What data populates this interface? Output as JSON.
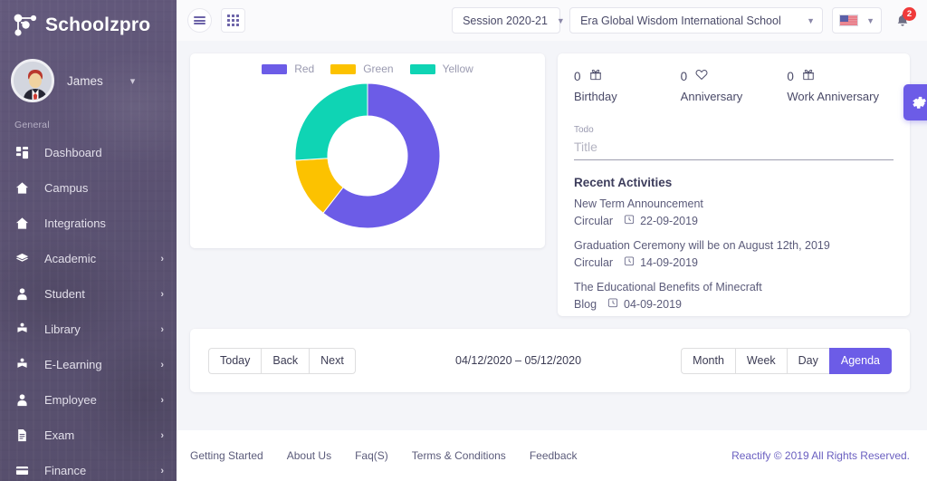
{
  "brand": {
    "name": "Schoolzpro",
    "logo_icon": "schoolzpro-logo-icon"
  },
  "profile": {
    "name": "James",
    "caret_icon": "chevron-down-icon",
    "avatar_icon": "user-avatar"
  },
  "sidebar": {
    "section_label": "General",
    "items": [
      {
        "label": "Dashboard",
        "icon": "dashboard-grid-icon",
        "arrow": ""
      },
      {
        "label": "Campus",
        "icon": "home-icon",
        "arrow": ""
      },
      {
        "label": "Integrations",
        "icon": "home-icon",
        "arrow": ""
      },
      {
        "label": "Academic",
        "icon": "books-stack-icon",
        "arrow": "›"
      },
      {
        "label": "Student",
        "icon": "user-icon",
        "arrow": "›"
      },
      {
        "label": "Library",
        "icon": "book-reader-icon",
        "arrow": "›"
      },
      {
        "label": "E-Learning",
        "icon": "book-reader-icon",
        "arrow": "›"
      },
      {
        "label": "Employee",
        "icon": "user-icon",
        "arrow": "›"
      },
      {
        "label": "Exam",
        "icon": "document-icon",
        "arrow": "›"
      },
      {
        "label": "Finance",
        "icon": "credit-card-icon",
        "arrow": "›"
      }
    ]
  },
  "topbar": {
    "menu_icon": "hamburger-menu-icon",
    "apps_icon": "apps-grid-icon",
    "session": {
      "value": "Session 2020-21",
      "caret_icon": "chevron-down-icon"
    },
    "school": {
      "value": "Era Global Wisdom International School",
      "caret_icon": "chevron-down-icon"
    },
    "language": {
      "flag": "us-flag-icon",
      "caret_icon": "chevron-down-icon"
    },
    "notifications": {
      "icon": "bell-icon",
      "count": "2",
      "badge_color": "#f03a3a"
    }
  },
  "chart_data": {
    "type": "pie",
    "title": "",
    "donut": true,
    "legend_position": "top",
    "labels": [
      "Red",
      "Green",
      "Yellow"
    ],
    "values": [
      60.5,
      13.5,
      26.0
    ],
    "colors": [
      "#6c5ce7",
      "#fcc200",
      "#0fd4b4"
    ],
    "inner_radius_ratio": 0.55,
    "start_angle": 0
  },
  "side_card": {
    "stats": [
      {
        "count": "0",
        "label": "Birthday",
        "icon": "gift-icon"
      },
      {
        "count": "0",
        "label": "Anniversary",
        "icon": "heart-icon"
      },
      {
        "count": "0",
        "label": "Work Anniversary",
        "icon": "gift-icon"
      }
    ],
    "todo": {
      "label": "Todo",
      "placeholder": "Title",
      "value": ""
    },
    "recent_title": "Recent Activities",
    "activities": [
      {
        "title": "New Term Announcement",
        "type": "Circular",
        "date": "22-09-2019",
        "clock_icon": "clock-icon"
      },
      {
        "title": "Graduation Ceremony will be on August 12th, 2019",
        "type": "Circular",
        "date": "14-09-2019",
        "clock_icon": "clock-icon"
      },
      {
        "title": "The Educational Benefits of Minecraft",
        "type": "Blog",
        "date": "04-09-2019",
        "clock_icon": "clock-icon"
      }
    ],
    "settings_tab": {
      "icon": "gear-icon",
      "color": "#6c5ce7"
    }
  },
  "calendar": {
    "nav": [
      "Today",
      "Back",
      "Next"
    ],
    "range": "04/12/2020 – 05/12/2020",
    "views": [
      "Month",
      "Week",
      "Day",
      "Agenda"
    ],
    "active_view": "Agenda",
    "active_color": "#6c5ce7"
  },
  "footer": {
    "links": [
      "Getting Started",
      "About Us",
      "Faq(S)",
      "Terms & Conditions",
      "Feedback"
    ],
    "copyright": "Reactify © 2019 All Rights Reserved."
  }
}
